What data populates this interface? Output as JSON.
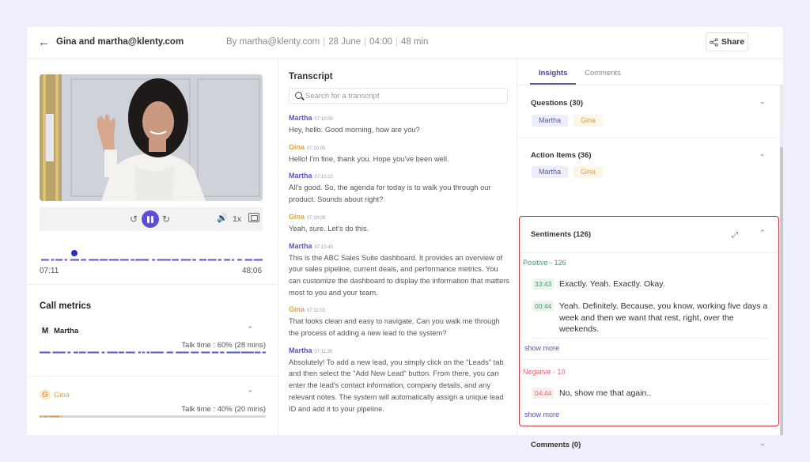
{
  "header": {
    "title": "Gina and martha@klenty.com",
    "meta": {
      "author": "By martha@klenty.com",
      "date": "28 June",
      "time": "04:00",
      "duration": "48 min"
    },
    "share_label": "Share"
  },
  "player": {
    "speed": "1x",
    "current_time": "07:11",
    "total_time": "48:06",
    "progress": 0.15,
    "state": "playing"
  },
  "call_metrics": {
    "title": "Call metrics",
    "speakers": [
      {
        "initial": "M",
        "name": "Martha",
        "talk_time": "Talk time : 60% (28 mins)",
        "share": 0.6,
        "color": "#5b54c8"
      },
      {
        "initial": "G",
        "name": "Gina",
        "talk_time": "Talk time : 40% (20 mins)",
        "share": 0.4,
        "color": "#e0a24e"
      }
    ]
  },
  "transcript": {
    "title": "Transcript",
    "search_placeholder": "Search for a transcript",
    "entries": [
      {
        "speaker": "Martha",
        "time": "07:10:00",
        "text": "Hey, hello. Good morning, how are you?"
      },
      {
        "speaker": "Gina",
        "time": "07:10:05",
        "text": "Hello! I'm fine, thank you. Hope you've been well."
      },
      {
        "speaker": "Martha",
        "time": "07:10:13",
        "text": "All's good. So, the agenda for today is to walk you through our product. Sounds about right?"
      },
      {
        "speaker": "Gina",
        "time": "07:10:28",
        "text": "Yeah, sure. Let's do this."
      },
      {
        "speaker": "Martha",
        "time": "07:10:40",
        "text": "This is the ABC Sales Suite dashboard. It provides an overview of your sales pipeline, current deals, and performance metrics. You can customize the dashboard to display the information that matters most to you and your team."
      },
      {
        "speaker": "Gina",
        "time": "07:11:03",
        "text": "That looks clean and easy to navigate. Can you walk me through the process of adding a new lead to the system?"
      },
      {
        "speaker": "Martha",
        "time": "07:11:30",
        "text": "Absolutely! To add a new lead, you simply click on the \"Leads\" tab and then select the \"Add New Lead\" button. From there, you can enter the lead's contact information, company details, and any relevant notes. The system will automatically assign a unique lead ID and add it to your pipeline."
      }
    ]
  },
  "insights": {
    "tabs": [
      {
        "label": "Insights",
        "active": true
      },
      {
        "label": "Comments",
        "active": false
      }
    ],
    "questions": {
      "title": "Questions (30)",
      "pills": [
        "Martha",
        "Gina"
      ]
    },
    "action_items": {
      "title": "Action Items (36)",
      "pills": [
        "Martha",
        "Gina"
      ]
    },
    "sentiments": {
      "title": "Sentiments (126)",
      "positive": {
        "label": "Positive - 126",
        "items": [
          {
            "time": "33:43",
            "text": "Exactly. Yeah. Exactly. Okay."
          },
          {
            "time": "00:44",
            "text": "Yeah. Definitely. Because, you know, working five days a week and then we want that rest, right, over the weekends."
          }
        ],
        "show_more": "show more"
      },
      "negative": {
        "label": "Negative - 10",
        "items": [
          {
            "time": "04:44",
            "text": "No, show me that again.."
          }
        ],
        "show_more": "show more"
      }
    },
    "comments": {
      "title": "Comments (0)"
    }
  },
  "colors": {
    "accent": "#5b4fd6",
    "martha": "#5b54c8",
    "gina": "#e0a24e",
    "positive": "#4a9a6a",
    "negative": "#e06a70",
    "highlight_border": "#c8383c"
  }
}
